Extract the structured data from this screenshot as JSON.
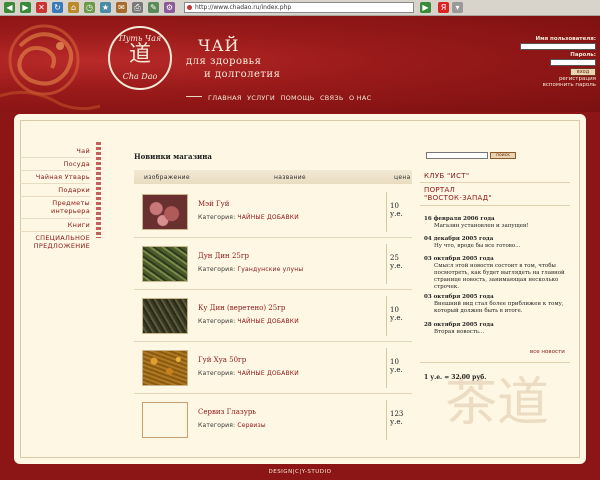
{
  "browser": {
    "url": "http://www.chadao.ru/index.php"
  },
  "header": {
    "logo_top": "Путь Чая",
    "logo_bottom": "Cha Dao",
    "logo_glyph": "道",
    "title": "ЧАЙ",
    "subtitle_line1": "для здоровья",
    "subtitle_line2": "и долголетия",
    "nav": [
      "ГЛАВНАЯ",
      "УСЛУГИ",
      "ПОМОЩЬ",
      "СВЯЗЬ",
      "О НАС"
    ]
  },
  "login": {
    "user_label": "Имя пользователя:",
    "password_label": "Пароль:",
    "button_label": "вход",
    "register_label": "регистрация",
    "forgot_label": "вспомнить пароль"
  },
  "sidebar": {
    "items": [
      "Чай",
      "Посуда",
      "Чайная Утварь",
      "Подарки",
      "Предметы интерьера",
      "Книги",
      "СПЕЦИАЛЬНОЕ ПРЕДЛОЖЕНИЕ"
    ]
  },
  "products": {
    "heading": "Новинки магазина",
    "columns": {
      "image": "изображение",
      "name": "название",
      "price": "цена"
    },
    "category_prefix": "Категория:",
    "rows": [
      {
        "name": "Мэй Гуй",
        "category": "ЧАЙНЫЕ ДОБАВКИ",
        "price": "10 у.е."
      },
      {
        "name": "Дун Дин 25гр",
        "category": "Гуандунские улуны",
        "price": "25 у.е."
      },
      {
        "name": "Ку Дин (веретено) 25гр",
        "category": "ЧАЙНЫЕ ДОБАВКИ",
        "price": "10 у.е."
      },
      {
        "name": "Гуй Хуа 50гр",
        "category": "ЧАЙНЫЕ ДОБАВКИ",
        "price": "10 у.е."
      },
      {
        "name": "Сервиз Глазурь",
        "category": "Сервизы",
        "price": "123 у.е."
      }
    ]
  },
  "right": {
    "search_button": "поиск",
    "club_link": "КЛУБ \"ИСТ\"",
    "portal_link_line1": "ПОРТАЛ",
    "portal_link_line2": "\"ВОСТОК-ЗАПАД\"",
    "news": [
      {
        "date": "16 февраля 2006 года",
        "text": "Магазин установлен и запущен!"
      },
      {
        "date": "04 декабря 2005 года",
        "text": "Ну что, вроде бы все готово..."
      },
      {
        "date": "03 октября 2005 года",
        "text": "Смысл этой новости состоит в том, чтобы посмотреть, как будет выглядеть на главной странице новость, занимающая несколько строчек."
      },
      {
        "date": "03 октября 2005 года",
        "text": "Внешний вид стал более приближен к тому, который должен быть в итоге."
      },
      {
        "date": "28 октября 2005 года",
        "text": "Вторая новость..."
      }
    ],
    "all_news": "все новости",
    "rate": "1 у.е. = 32.00 руб.",
    "watermark": "茶道"
  },
  "footer": {
    "credit": "DESIGN|C|Y-STUDIO"
  }
}
